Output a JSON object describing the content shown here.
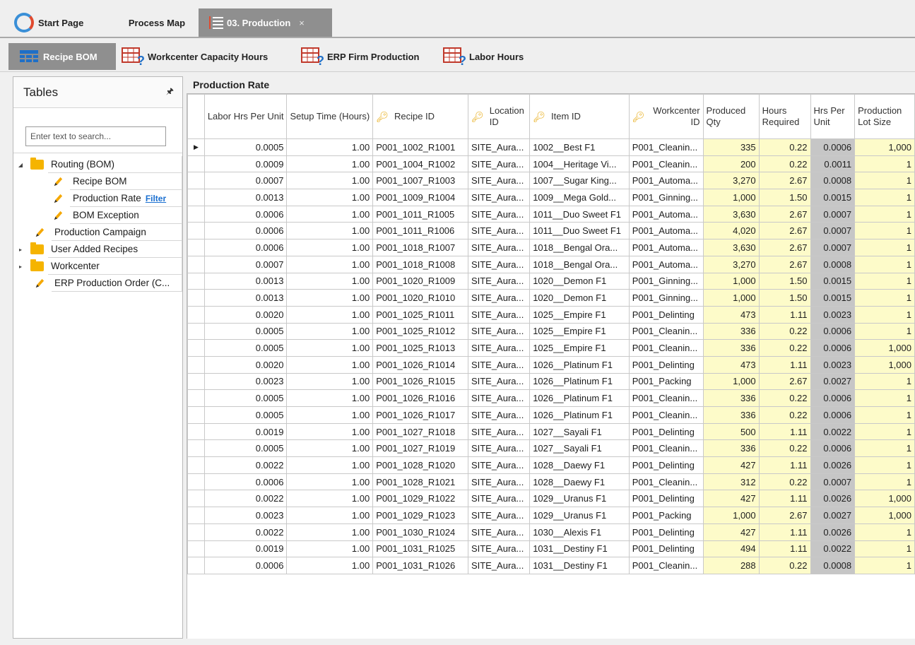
{
  "doc_tabs": {
    "start_page": "Start Page",
    "process_map": "Process Map",
    "production": "03. Production",
    "close": "×"
  },
  "sub_tabs": {
    "recipe_bom": "Recipe BOM",
    "workcenter_capacity": "Workcenter Capacity Hours",
    "erp_firm": "ERP Firm Production",
    "labor_hours": "Labor Hours"
  },
  "tables_panel": {
    "title": "Tables",
    "search_placeholder": "Enter text to search...",
    "tree": {
      "routing": "Routing (BOM)",
      "recipe_bom": "Recipe BOM",
      "production_rate": "Production Rate",
      "filter": "Filter",
      "bom_exception": "BOM Exception",
      "production_campaign": "Production Campaign",
      "user_added": "User Added Recipes",
      "workcenter": "Workcenter",
      "erp_order": "ERP Production Order (C..."
    }
  },
  "grid": {
    "title": "Production Rate",
    "headers": [
      "Labor Hrs Per Unit",
      "Setup Time (Hours)",
      "Recipe ID",
      "Location ID",
      "Item ID",
      "Workcenter ID",
      "Produced Qty",
      "Hours Required",
      "Hrs Per Unit",
      "Production Lot Size"
    ],
    "rows": [
      [
        "0.0005",
        "1.00",
        "P001_1002_R1001",
        "SITE_Aura...",
        "1002__Best F1",
        "P001_Cleanin...",
        "335",
        "0.22",
        "0.0006",
        "1,000"
      ],
      [
        "0.0009",
        "1.00",
        "P001_1004_R1002",
        "SITE_Aura...",
        "1004__Heritage Vi...",
        "P001_Cleanin...",
        "200",
        "0.22",
        "0.0011",
        "1"
      ],
      [
        "0.0007",
        "1.00",
        "P001_1007_R1003",
        "SITE_Aura...",
        "1007__Sugar King...",
        "P001_Automa...",
        "3,270",
        "2.67",
        "0.0008",
        "1"
      ],
      [
        "0.0013",
        "1.00",
        "P001_1009_R1004",
        "SITE_Aura...",
        "1009__Mega Gold...",
        "P001_Ginning...",
        "1,000",
        "1.50",
        "0.0015",
        "1"
      ],
      [
        "0.0006",
        "1.00",
        "P001_1011_R1005",
        "SITE_Aura...",
        "1011__Duo Sweet F1",
        "P001_Automa...",
        "3,630",
        "2.67",
        "0.0007",
        "1"
      ],
      [
        "0.0006",
        "1.00",
        "P001_1011_R1006",
        "SITE_Aura...",
        "1011__Duo Sweet F1",
        "P001_Automa...",
        "4,020",
        "2.67",
        "0.0007",
        "1"
      ],
      [
        "0.0006",
        "1.00",
        "P001_1018_R1007",
        "SITE_Aura...",
        "1018__Bengal Ora...",
        "P001_Automa...",
        "3,630",
        "2.67",
        "0.0007",
        "1"
      ],
      [
        "0.0007",
        "1.00",
        "P001_1018_R1008",
        "SITE_Aura...",
        "1018__Bengal Ora...",
        "P001_Automa...",
        "3,270",
        "2.67",
        "0.0008",
        "1"
      ],
      [
        "0.0013",
        "1.00",
        "P001_1020_R1009",
        "SITE_Aura...",
        "1020__Demon F1",
        "P001_Ginning...",
        "1,000",
        "1.50",
        "0.0015",
        "1"
      ],
      [
        "0.0013",
        "1.00",
        "P001_1020_R1010",
        "SITE_Aura...",
        "1020__Demon F1",
        "P001_Ginning...",
        "1,000",
        "1.50",
        "0.0015",
        "1"
      ],
      [
        "0.0020",
        "1.00",
        "P001_1025_R1011",
        "SITE_Aura...",
        "1025__Empire F1",
        "P001_Delinting",
        "473",
        "1.11",
        "0.0023",
        "1"
      ],
      [
        "0.0005",
        "1.00",
        "P001_1025_R1012",
        "SITE_Aura...",
        "1025__Empire F1",
        "P001_Cleanin...",
        "336",
        "0.22",
        "0.0006",
        "1"
      ],
      [
        "0.0005",
        "1.00",
        "P001_1025_R1013",
        "SITE_Aura...",
        "1025__Empire F1",
        "P001_Cleanin...",
        "336",
        "0.22",
        "0.0006",
        "1,000"
      ],
      [
        "0.0020",
        "1.00",
        "P001_1026_R1014",
        "SITE_Aura...",
        "1026__Platinum F1",
        "P001_Delinting",
        "473",
        "1.11",
        "0.0023",
        "1,000"
      ],
      [
        "0.0023",
        "1.00",
        "P001_1026_R1015",
        "SITE_Aura...",
        "1026__Platinum F1",
        "P001_Packing",
        "1,000",
        "2.67",
        "0.0027",
        "1"
      ],
      [
        "0.0005",
        "1.00",
        "P001_1026_R1016",
        "SITE_Aura...",
        "1026__Platinum F1",
        "P001_Cleanin...",
        "336",
        "0.22",
        "0.0006",
        "1"
      ],
      [
        "0.0005",
        "1.00",
        "P001_1026_R1017",
        "SITE_Aura...",
        "1026__Platinum F1",
        "P001_Cleanin...",
        "336",
        "0.22",
        "0.0006",
        "1"
      ],
      [
        "0.0019",
        "1.00",
        "P001_1027_R1018",
        "SITE_Aura...",
        "1027__Sayali F1",
        "P001_Delinting",
        "500",
        "1.11",
        "0.0022",
        "1"
      ],
      [
        "0.0005",
        "1.00",
        "P001_1027_R1019",
        "SITE_Aura...",
        "1027__Sayali F1",
        "P001_Cleanin...",
        "336",
        "0.22",
        "0.0006",
        "1"
      ],
      [
        "0.0022",
        "1.00",
        "P001_1028_R1020",
        "SITE_Aura...",
        "1028__Daewy F1",
        "P001_Delinting",
        "427",
        "1.11",
        "0.0026",
        "1"
      ],
      [
        "0.0006",
        "1.00",
        "P001_1028_R1021",
        "SITE_Aura...",
        "1028__Daewy F1",
        "P001_Cleanin...",
        "312",
        "0.22",
        "0.0007",
        "1"
      ],
      [
        "0.0022",
        "1.00",
        "P001_1029_R1022",
        "SITE_Aura...",
        "1029__Uranus F1",
        "P001_Delinting",
        "427",
        "1.11",
        "0.0026",
        "1,000"
      ],
      [
        "0.0023",
        "1.00",
        "P001_1029_R1023",
        "SITE_Aura...",
        "1029__Uranus F1",
        "P001_Packing",
        "1,000",
        "2.67",
        "0.0027",
        "1,000"
      ],
      [
        "0.0022",
        "1.00",
        "P001_1030_R1024",
        "SITE_Aura...",
        "1030__Alexis F1",
        "P001_Delinting",
        "427",
        "1.11",
        "0.0026",
        "1"
      ],
      [
        "0.0019",
        "1.00",
        "P001_1031_R1025",
        "SITE_Aura...",
        "1031__Destiny F1",
        "P001_Delinting",
        "494",
        "1.11",
        "0.0022",
        "1"
      ],
      [
        "0.0006",
        "1.00",
        "P001_1031_R1026",
        "SITE_Aura...",
        "1031__Destiny F1",
        "P001_Cleanin...",
        "288",
        "0.22",
        "0.0008",
        "1"
      ]
    ],
    "current_row_marker": "▶",
    "colors": {
      "editable_yellow": "#fdfbc9",
      "readonly_gray": "#c6c6c6",
      "key_icon": "#e6a400"
    }
  }
}
